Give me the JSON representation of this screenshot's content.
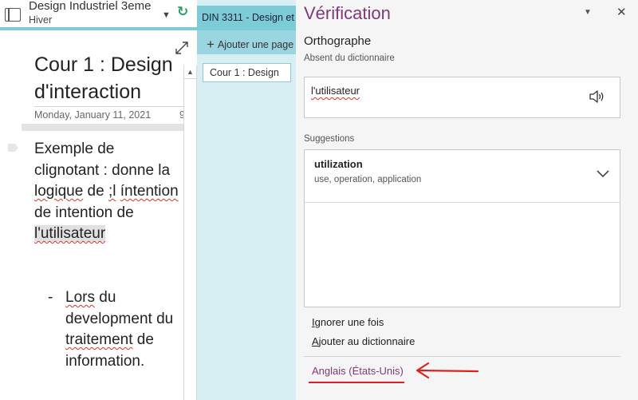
{
  "notebook": {
    "title": "Design Industriel 3eme",
    "section": "Hiver"
  },
  "page": {
    "title": "Cour 1 : Design d'interaction",
    "date": "Monday, January 11, 2021",
    "date_cut": "9",
    "paragraph": {
      "p1": "Exemple de clignotant : donne la ",
      "w_logique": "logique",
      "p2": " de ",
      "w_l": ";l",
      "p3": " ",
      "w_intention": "íntention",
      "p4": " de intention de ",
      "w_utilisateur": "l'utilisateur"
    },
    "bullet": {
      "dash": "-",
      "w_lors": "Lors",
      "p1": " du development du ",
      "w_traitement": "traitement",
      "p2": " de information."
    }
  },
  "tabs": {
    "section_tab": "DIN 3311 - Design et",
    "add_page": "Ajouter une page",
    "page_tab": "Cour 1 : Design"
  },
  "verification": {
    "title": "Vérification",
    "heading": "Orthographe",
    "absent_label": "Absent du dictionnaire",
    "misspelled_word": "l'utilisateur",
    "suggestions_label": "Suggestions",
    "suggestion": {
      "word": "utilization",
      "synonyms": "use, operation, application"
    },
    "ignore_once": {
      "first": "I",
      "rest": "gnorer une fois"
    },
    "add_dictionary": {
      "first": "A",
      "rest": "jouter au dictionnaire"
    },
    "language": "Anglais (États-Unis)"
  },
  "colors": {
    "accent_purple": "#80397b",
    "tab_teal": "#7ecbd8",
    "annotation_red": "#e02020"
  },
  "icons": {
    "notebook": "notebook-icon",
    "sync": "sync-icon",
    "expand": "expand-icon",
    "speaker": "speaker-icon",
    "chevron": "chevron-down-icon"
  }
}
